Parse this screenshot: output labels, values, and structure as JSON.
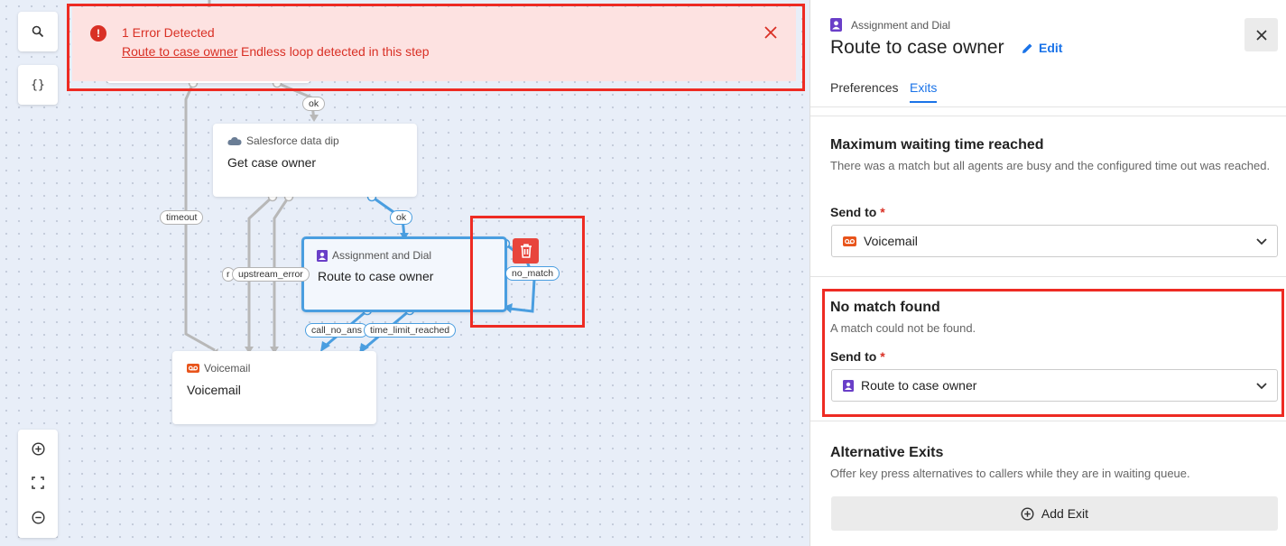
{
  "canvas": {
    "tools": {
      "search_icon": "search-icon",
      "variables_label": "{}"
    },
    "nodes": {
      "salesforce": {
        "type": "Salesforce data dip",
        "title": "Get case owner"
      },
      "assignment": {
        "type": "Assignment and Dial",
        "title": "Route to case owner"
      },
      "voicemail": {
        "type": "Voicemail",
        "title": "Voicemail"
      }
    },
    "edge_labels": {
      "ok_top": "ok",
      "ok_mid": "ok",
      "timeout": "timeout",
      "r_partial": "r",
      "upstream_error": "upstream_error",
      "no_match": "no_match",
      "call_no_answer": "call_no_ans",
      "time_limit_reached": "time_limit_reached"
    }
  },
  "error_banner": {
    "title": "1 Error Detected",
    "link": "Route to case owner",
    "message": "Endless loop detected in this step"
  },
  "panel": {
    "node_type": "Assignment and Dial",
    "title": "Route to case owner",
    "edit_label": "Edit",
    "tabs": [
      {
        "label": "Preferences",
        "active": false
      },
      {
        "label": "Exits",
        "active": true
      }
    ],
    "sections": {
      "max_wait": {
        "title": "Maximum waiting time reached",
        "description": "There was a match but all agents are busy and the configured time out was reached.",
        "send_to_label": "Send to",
        "send_to_value": "Voicemail"
      },
      "no_match": {
        "title": "No match found",
        "description": "A match could not be found.",
        "send_to_label": "Send to",
        "send_to_value": "Route to case owner"
      },
      "alt_exits": {
        "title": "Alternative Exits",
        "description": "Offer key press alternatives to callers while they are in waiting queue.",
        "add_exit_label": "Add Exit"
      }
    },
    "required_marker": "*"
  },
  "colors": {
    "accent_blue": "#1a73e8",
    "edge_blue": "#4a9ee0",
    "edge_gray": "#b3b3b3",
    "error_red": "#d93025",
    "error_bg": "#fde2e1",
    "highlight_red": "#ee2b23",
    "assignment_purple": "#6a3fc8",
    "voicemail_orange": "#e8541b"
  }
}
